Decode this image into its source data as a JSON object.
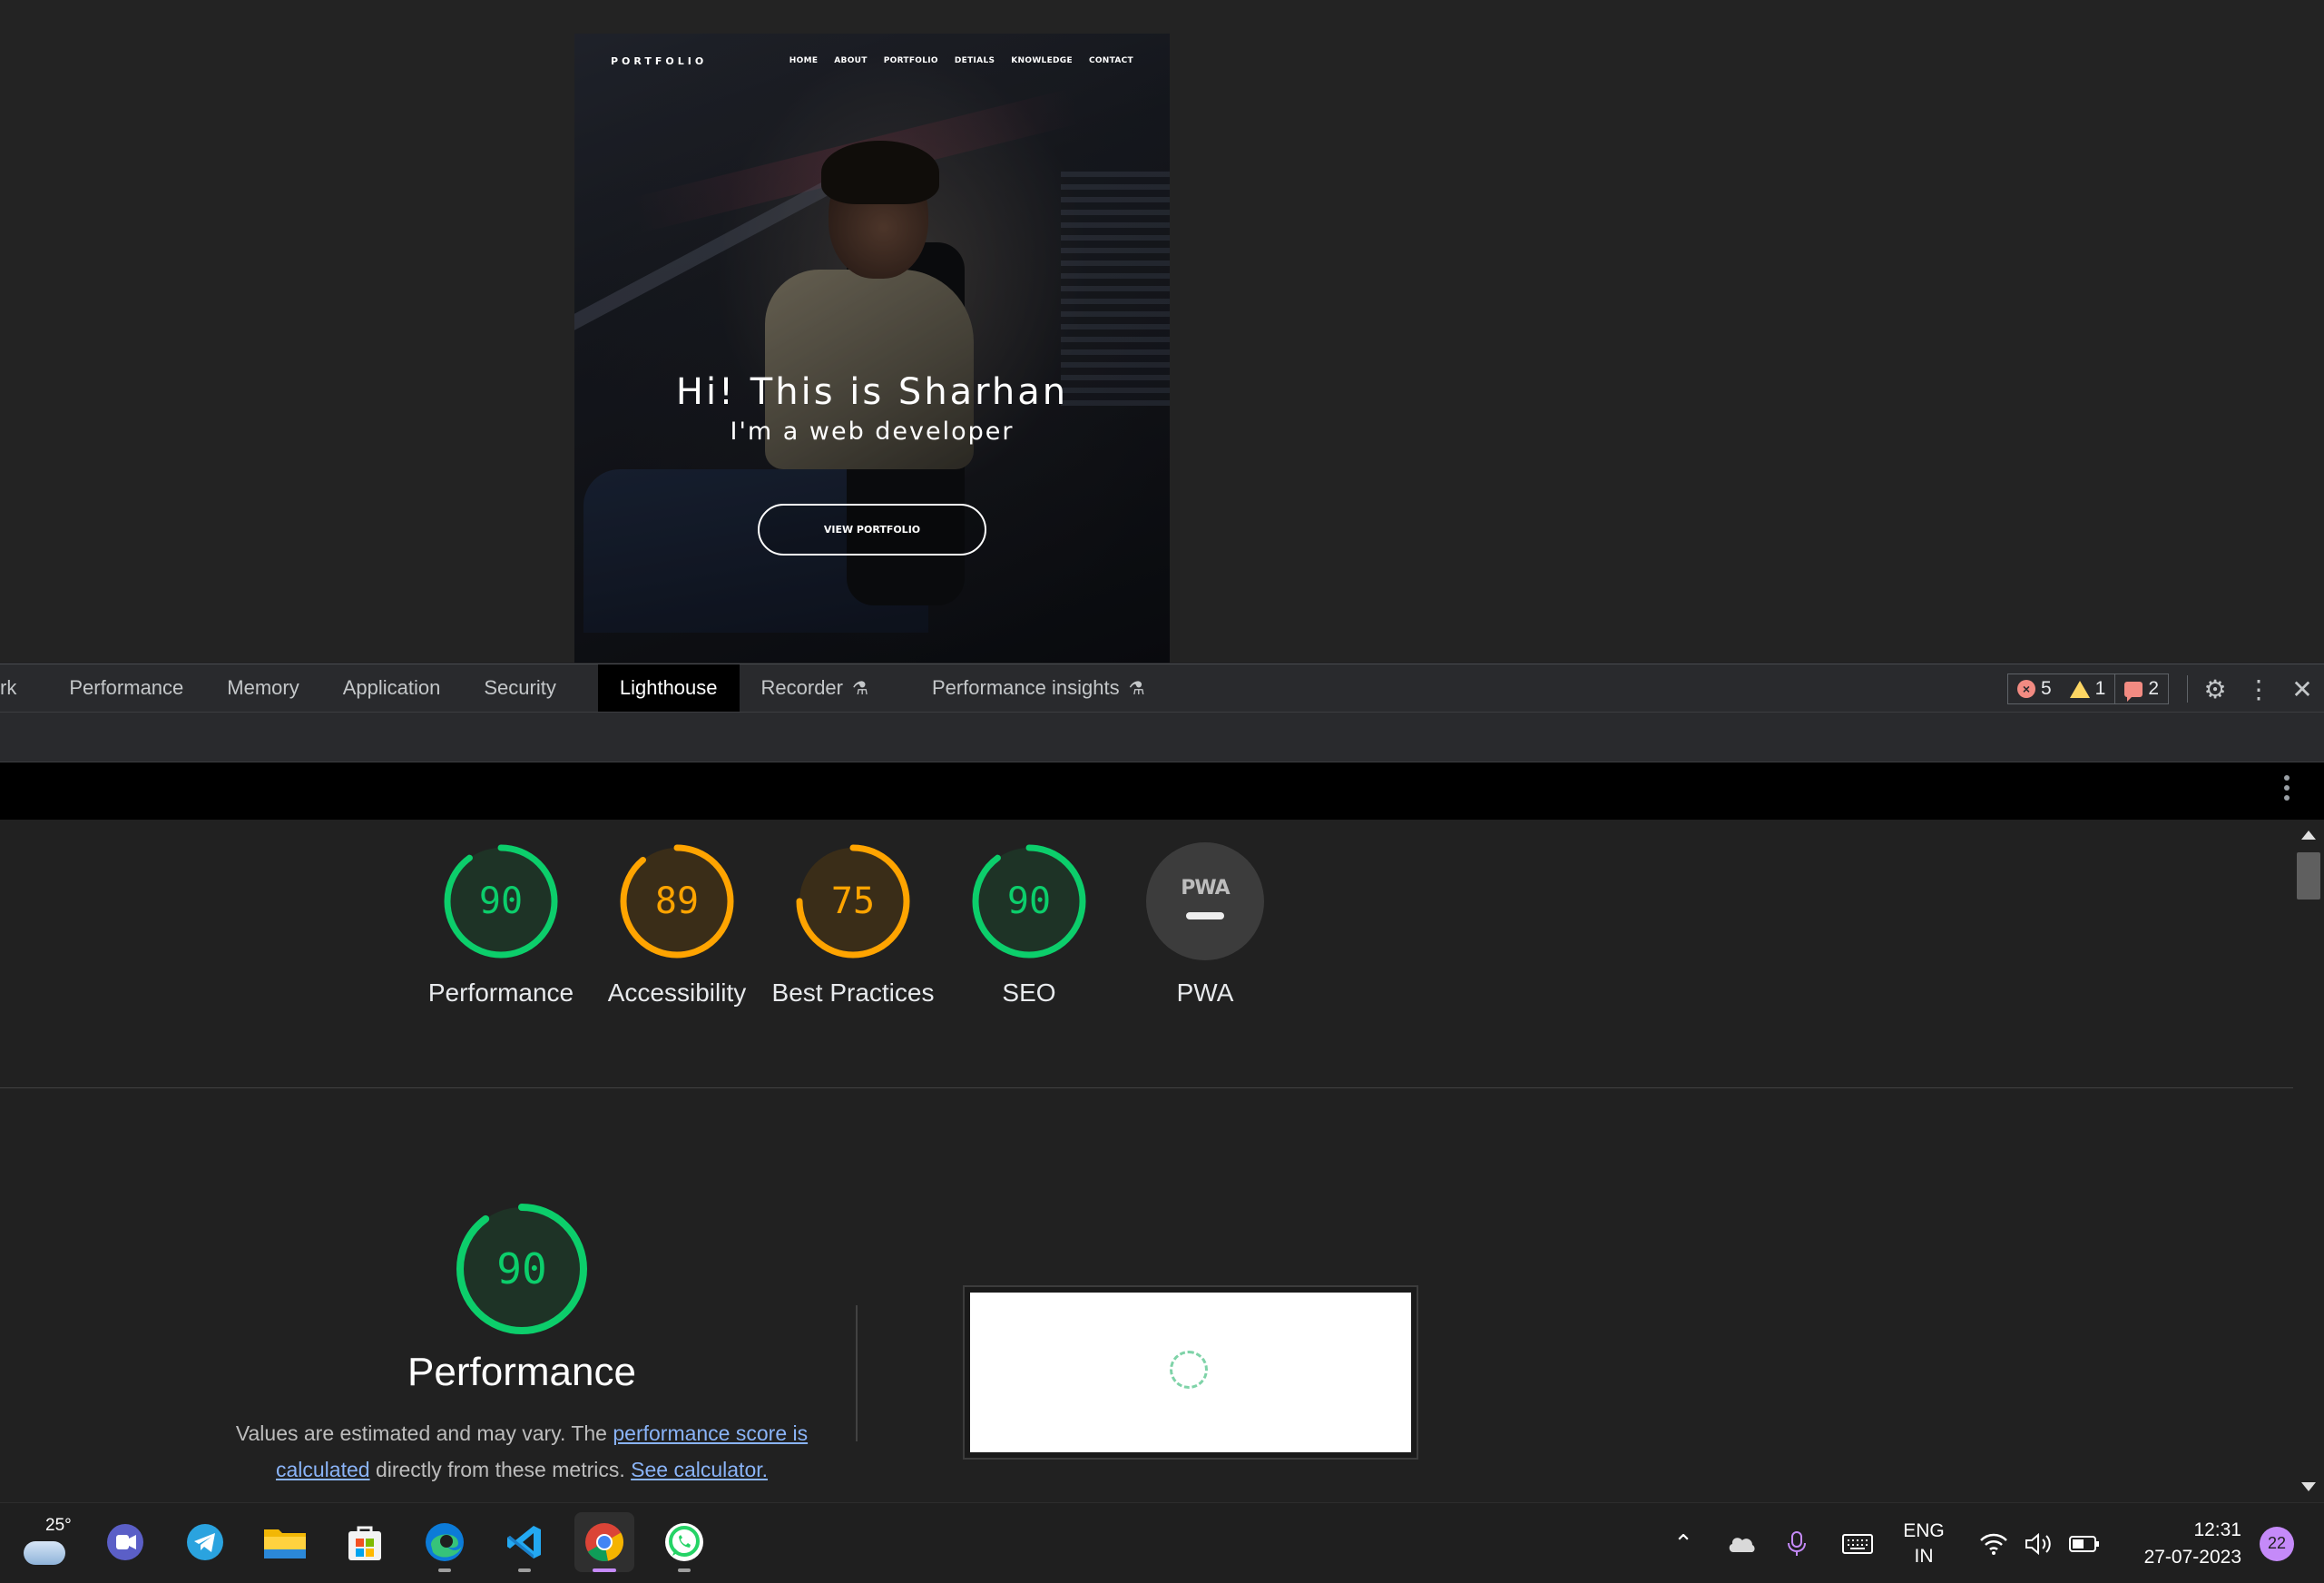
{
  "site": {
    "logo": "PORTFOLIO",
    "nav": [
      "HOME",
      "ABOUT",
      "PORTFOLIO",
      "DETIALS",
      "KNOWLEDGE",
      "CONTACT"
    ],
    "hero_title": "Hi! This is Sharhan",
    "hero_subtitle": "I'm a web developer",
    "cta": "VIEW PORTFOLIO"
  },
  "devtools": {
    "tabs": [
      "rk",
      "Performance",
      "Memory",
      "Application",
      "Security",
      "Lighthouse",
      "Recorder",
      "Performance insights"
    ],
    "active_tab": "Lighthouse",
    "counts": {
      "errors": "5",
      "warnings": "1",
      "issues": "2"
    }
  },
  "lighthouse": {
    "scores": [
      {
        "label": "Performance",
        "score": "90",
        "color": "#0cce6b"
      },
      {
        "label": "Accessibility",
        "score": "89",
        "color": "#ffa400"
      },
      {
        "label": "Best Practices",
        "score": "75",
        "color": "#ffa400"
      },
      {
        "label": "SEO",
        "score": "90",
        "color": "#0cce6b"
      }
    ],
    "pwa": {
      "label": "PWA",
      "badge": "PWA"
    },
    "perf": {
      "score": "90",
      "title": "Performance",
      "desc_1": "Values are estimated and may vary. The ",
      "link_1": "performance score is calculated",
      "desc_2": " directly from these metrics. ",
      "link_2": "See calculator."
    }
  },
  "taskbar": {
    "weather_temp": "25°",
    "apps": [
      "teams-icon",
      "telegram-icon",
      "file-explorer-icon",
      "store-icon",
      "edge-icon",
      "vscode-icon",
      "chrome-icon",
      "whatsapp-icon"
    ],
    "lang_1": "ENG",
    "lang_2": "IN",
    "time": "12:31",
    "date": "27-07-2023",
    "notifications": "22"
  }
}
